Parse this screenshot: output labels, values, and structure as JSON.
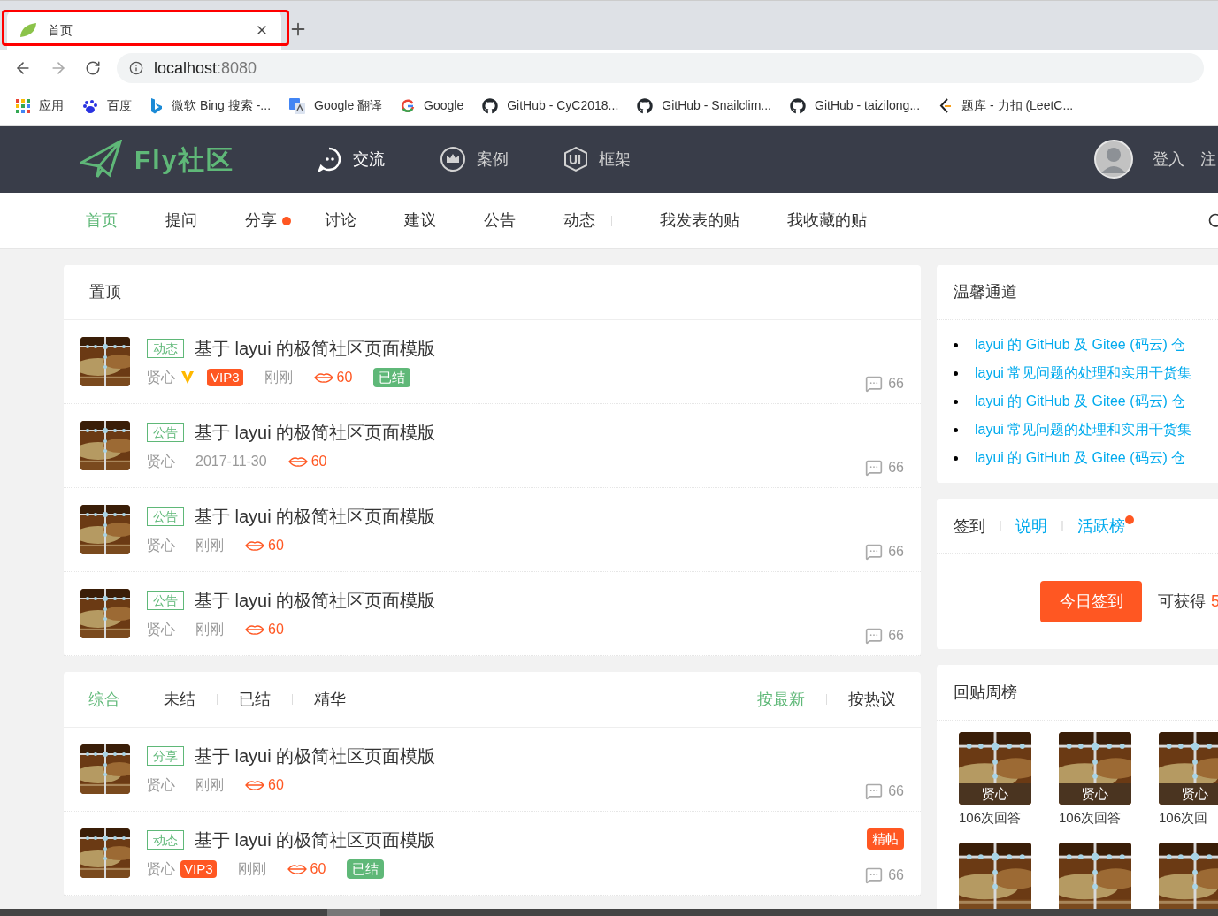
{
  "browser": {
    "tab": {
      "title": "首页",
      "selected": true
    },
    "address": {
      "host": "localhost",
      "port": ":8080"
    },
    "bookmarks": [
      {
        "kind": "apps",
        "label": "应用"
      },
      {
        "kind": "baidu",
        "label": "百度"
      },
      {
        "kind": "bing",
        "label": "微软 Bing 搜索 -..."
      },
      {
        "kind": "translate",
        "label": "Google 翻译"
      },
      {
        "kind": "google",
        "label": "Google"
      },
      {
        "kind": "github",
        "label": "GitHub - CyC2018..."
      },
      {
        "kind": "github",
        "label": "GitHub - Snailclim..."
      },
      {
        "kind": "github",
        "label": "GitHub - taizilong..."
      },
      {
        "kind": "leetcode",
        "label": "题库 - 力扣 (LeetC..."
      }
    ]
  },
  "header": {
    "logo": "Fly社区",
    "nav": [
      {
        "kind": "chat",
        "label": "交流",
        "selected": true
      },
      {
        "kind": "crown",
        "label": "案例",
        "selected": false
      },
      {
        "kind": "ui",
        "label": "框架",
        "selected": false
      }
    ],
    "login": "登入",
    "register": "注"
  },
  "subnav": {
    "items": [
      {
        "label": "首页",
        "selected": true,
        "dot": false
      },
      {
        "label": "提问",
        "selected": false,
        "dot": false
      },
      {
        "label": "分享",
        "selected": false,
        "dot": true
      },
      {
        "label": "讨论",
        "selected": false,
        "dot": false
      },
      {
        "label": "建议",
        "selected": false,
        "dot": false
      },
      {
        "label": "公告",
        "selected": false,
        "dot": false
      },
      {
        "label": "动态",
        "selected": false,
        "dot": false
      }
    ],
    "mine": [
      "我发表的贴",
      "我收藏的贴"
    ]
  },
  "top_panel": {
    "title": "置顶",
    "posts": [
      {
        "tag": "动态",
        "title": "基于 layui 的极简社区页面模版",
        "author": "贤心",
        "verified": true,
        "vip": "VIP3",
        "time": "刚刚",
        "kisses": "60",
        "solved": "已结",
        "comments": "66"
      },
      {
        "tag": "公告",
        "title": "基于 layui 的极简社区页面模版",
        "author": "贤心",
        "verified": false,
        "time": "2017-11-30",
        "kisses": "60",
        "comments": "66"
      },
      {
        "tag": "公告",
        "title": "基于 layui 的极简社区页面模版",
        "author": "贤心",
        "verified": false,
        "time": "刚刚",
        "kisses": "60",
        "comments": "66"
      },
      {
        "tag": "公告",
        "title": "基于 layui 的极简社区页面模版",
        "author": "贤心",
        "verified": false,
        "time": "刚刚",
        "kisses": "60",
        "comments": "66"
      }
    ]
  },
  "list_panel": {
    "filters": [
      {
        "label": "综合",
        "selected": true
      },
      {
        "label": "未结",
        "selected": false
      },
      {
        "label": "已结",
        "selected": false
      },
      {
        "label": "精华",
        "selected": false
      }
    ],
    "sorts": [
      {
        "label": "按最新",
        "selected": true
      },
      {
        "label": "按热议",
        "selected": false
      }
    ],
    "posts": [
      {
        "tag": "分享",
        "title": "基于 layui 的极简社区页面模版",
        "author": "贤心",
        "verified": false,
        "time": "刚刚",
        "kisses": "60",
        "comments": "66"
      },
      {
        "tag": "动态",
        "title": "基于 layui 的极简社区页面模版",
        "author": "贤心",
        "verified": false,
        "vip": "VIP3",
        "time": "刚刚",
        "kisses": "60",
        "solved": "已结",
        "featured": "精帖",
        "comments": "66"
      }
    ]
  },
  "sidebar": {
    "channel": {
      "title": "温馨通道",
      "links": [
        "layui 的 GitHub 及 Gitee (码云) 仓",
        "layui 常见问题的处理和实用干货集",
        "layui 的 GitHub 及 Gitee (码云) 仓",
        "layui 常见问题的处理和实用干货集",
        "layui 的 GitHub 及 Gitee (码云) 仓"
      ]
    },
    "signin": {
      "tabs": [
        {
          "label": "签到",
          "kind": "plain",
          "dot": false
        },
        {
          "label": "说明",
          "kind": "link",
          "dot": false
        },
        {
          "label": "活跃榜",
          "kind": "link",
          "dot": true
        }
      ],
      "button": "今日签到",
      "reward_label": "可获得",
      "reward_value": "5"
    },
    "weekly": {
      "title": "回贴周榜",
      "users": [
        {
          "kind": "user",
          "name": "贤心",
          "answers": "106次回答"
        },
        {
          "kind": "user",
          "name": "贤心",
          "answers": "106次回答"
        },
        {
          "kind": "user",
          "name": "贤心",
          "answers": "106次回"
        },
        {
          "kind": "picture"
        },
        {
          "kind": "picture"
        },
        {
          "kind": "picture"
        }
      ]
    }
  }
}
